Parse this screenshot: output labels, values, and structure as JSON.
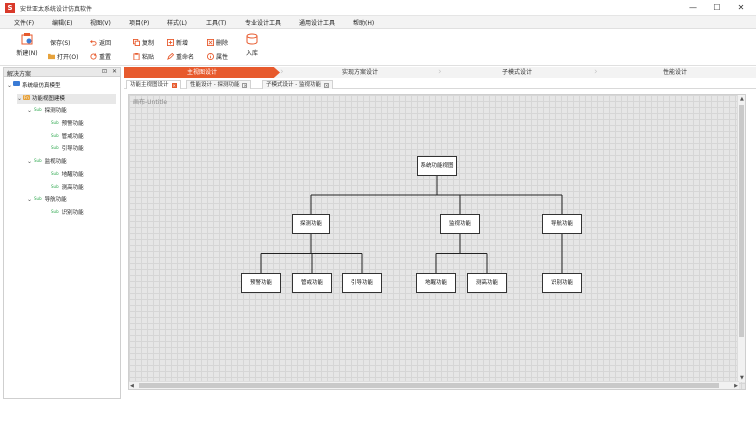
{
  "window": {
    "title": "安世亚太系统设计仿真软件",
    "app_icon": "S",
    "minimize": "—",
    "maximize": "☐",
    "close": "✕"
  },
  "menu": [
    "文件(F)",
    "编辑(E)",
    "视图(V)",
    "项目(P)",
    "样式(L)",
    "工具(T)",
    "专业设计工具",
    "通用设计工具",
    "帮助(H)"
  ],
  "toolbar": {
    "new": "新建(N)",
    "save": "保存(S)",
    "open": "打开(O)",
    "undo": "返回",
    "redo": "重置",
    "copy": "复制",
    "paste": "粘贴",
    "add": "新增",
    "rename": "重命名",
    "delete": "删除",
    "property": "属性",
    "import": "入库"
  },
  "panel": {
    "title": "解决方案",
    "pin": "⊡",
    "close": "✕",
    "tree": [
      {
        "label": "系统级仿真模型",
        "level": 0,
        "caret": "⌄",
        "icon": "folder"
      },
      {
        "label": "功能视图建模",
        "level": 1,
        "caret": "⌄",
        "icon": "Fn",
        "selected": true
      },
      {
        "label": "探测功能",
        "level": 2,
        "caret": "⌄",
        "icon": "Sub"
      },
      {
        "label": "预警功能",
        "level": 3,
        "caret": "",
        "icon": "Sub"
      },
      {
        "label": "管戒功能",
        "level": 3,
        "caret": "",
        "icon": "Sub"
      },
      {
        "label": "引导功能",
        "level": 3,
        "caret": "",
        "icon": "Sub"
      },
      {
        "label": "监视功能",
        "level": 2,
        "caret": "⌄",
        "icon": "Sub"
      },
      {
        "label": "地醒功能",
        "level": 3,
        "caret": "",
        "icon": "Sub"
      },
      {
        "label": "测高功能",
        "level": 3,
        "caret": "",
        "icon": "Sub"
      },
      {
        "label": "导航功能",
        "level": 2,
        "caret": "⌄",
        "icon": "Sub"
      },
      {
        "label": "识别功能",
        "level": 3,
        "caret": "",
        "icon": "Sub"
      }
    ]
  },
  "phases": [
    "主视图设计",
    "实现方案设计",
    "子模式设计",
    "性能设计"
  ],
  "doc_tabs": [
    {
      "label": "功能主视图设计",
      "close": "✕",
      "active": true
    },
    {
      "label": "性能设计 - 探测功能",
      "close": "✕",
      "active": false
    },
    {
      "label": "子模式设计 - 监视功能",
      "close": "✕",
      "active": false
    }
  ],
  "canvas": {
    "label": "画布-Untitle",
    "nodes": [
      {
        "id": "root",
        "label": "系统功能视图"
      },
      {
        "id": "detect",
        "label": "探测功能",
        "parent": "root"
      },
      {
        "id": "monitor",
        "label": "监视功能",
        "parent": "root"
      },
      {
        "id": "nav",
        "label": "导航功能",
        "parent": "root"
      },
      {
        "id": "warn",
        "label": "预警功能",
        "parent": "detect"
      },
      {
        "id": "guard",
        "label": "管戒功能",
        "parent": "detect"
      },
      {
        "id": "guide",
        "label": "引导功能",
        "parent": "detect"
      },
      {
        "id": "ground",
        "label": "地醒功能",
        "parent": "monitor"
      },
      {
        "id": "height",
        "label": "测高功能",
        "parent": "monitor"
      },
      {
        "id": "ident",
        "label": "识别功能",
        "parent": "nav"
      }
    ]
  },
  "colors": {
    "accent": "#e75a2d",
    "brand": "#d93a2b"
  }
}
